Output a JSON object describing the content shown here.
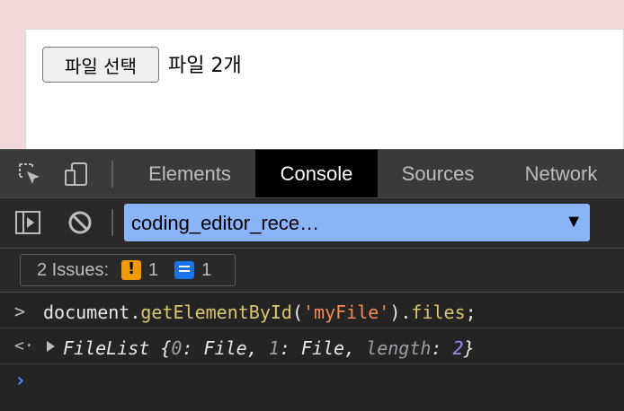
{
  "page": {
    "file_button_label": "파일 선택",
    "file_status": "파일 2개"
  },
  "devtools": {
    "tabs": [
      "Elements",
      "Console",
      "Sources",
      "Network"
    ],
    "active_tab": "Console",
    "context_selector": "coding_editor_rece…",
    "issues": {
      "label": "2 Issues:",
      "warning_count": "1",
      "info_count": "1"
    },
    "console": {
      "input": {
        "prefix": "document.",
        "fn": "getElementById",
        "open": "(",
        "arg": "'myFile'",
        "close": ").",
        "prop": "files",
        "end": ";"
      },
      "output": {
        "type": "FileList",
        "open": " {",
        "k0": "0",
        "v0": ": File, ",
        "k1": "1",
        "v1": ": File, ",
        "klen": "length",
        "colon": ": ",
        "vlen": "2",
        "close": "}"
      }
    }
  },
  "colors": {
    "accent_context": "#8ab4f8",
    "warning": "#f29900",
    "info": "#1a73e8"
  }
}
